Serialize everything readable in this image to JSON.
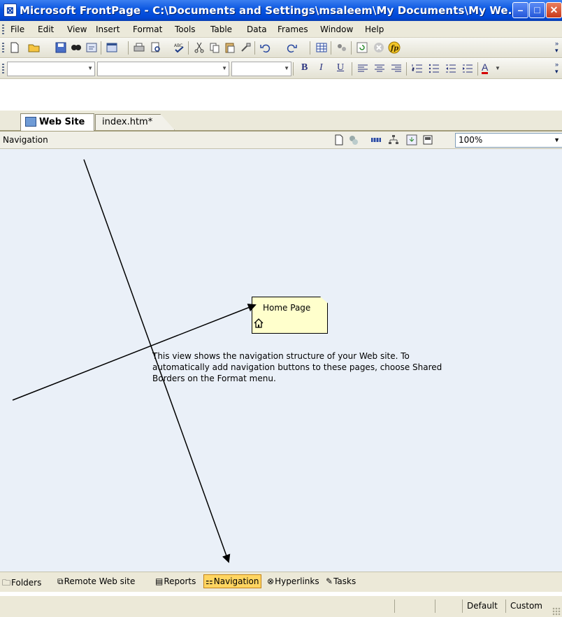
{
  "window": {
    "title": "Microsoft FrontPage - C:\\Documents and Settings\\msaleem\\My Documents\\My We...",
    "minimize": "–",
    "maximize": "□",
    "close": "✕"
  },
  "menu": [
    "File",
    "Edit",
    "View",
    "Insert",
    "Format",
    "Tools",
    "Table",
    "Data",
    "Frames",
    "Window",
    "Help"
  ],
  "toolbar": {
    "standard_icons": [
      "new-page-icon",
      "open-icon",
      "save-icon",
      "search-icon",
      "publish-icon",
      "web-component-icon",
      "print-icon",
      "print-preview-icon",
      "spelling-icon",
      "cut-icon",
      "copy-icon",
      "paste-icon",
      "format-painter-icon",
      "undo-icon",
      "redo-icon",
      "table-icon",
      "layers-icon",
      "refresh-icon",
      "stop-icon",
      "help-icon"
    ],
    "formatting": {
      "bold": "B",
      "italic": "I",
      "underline": "U",
      "font_color": "A"
    }
  },
  "tabs": [
    {
      "label": "Web Site",
      "active": true
    },
    {
      "label": "index.htm*",
      "active": false
    }
  ],
  "navigation_bar": {
    "label": "Navigation",
    "zoom": "100%"
  },
  "canvas": {
    "node_label": "Home Page",
    "description": "This view shows the navigation structure of your Web site. To automatically add navigation buttons to these pages, choose Shared Borders on the Format menu."
  },
  "views": [
    {
      "label": "Folders",
      "icon": "folder-icon",
      "active": false
    },
    {
      "label": "Remote Web site",
      "icon": "remote-web-icon",
      "active": false
    },
    {
      "label": "Reports",
      "icon": "reports-icon",
      "active": false
    },
    {
      "label": "Navigation",
      "icon": "navigation-icon",
      "active": true
    },
    {
      "label": "Hyperlinks",
      "icon": "hyperlinks-icon",
      "active": false
    },
    {
      "label": "Tasks",
      "icon": "tasks-icon",
      "active": false
    }
  ],
  "status": {
    "default": "Default",
    "custom": "Custom"
  },
  "colors": {
    "titlebar": "#0a55e0",
    "canvas": "#eaf0f8",
    "node": "#ffffcc",
    "active_view": "#ffd561"
  }
}
